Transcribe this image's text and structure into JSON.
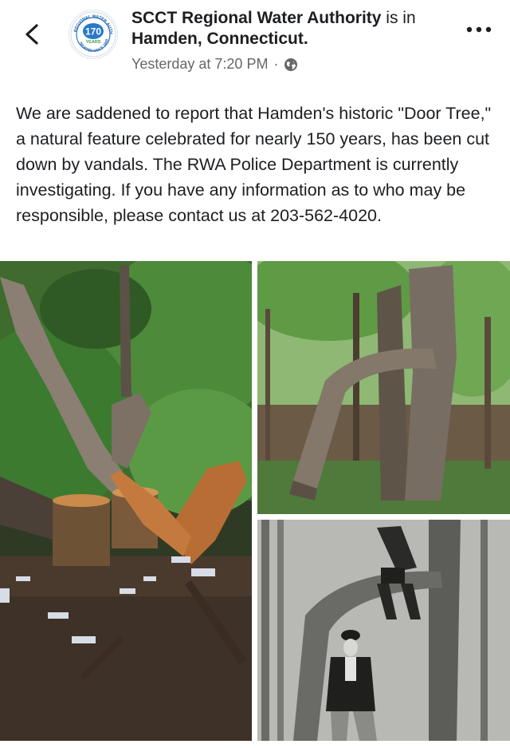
{
  "header": {
    "page_name": "SCCT Regional Water Authority",
    "checkin_prefix": " is in ",
    "location": "Hamden, Connecticut.",
    "timestamp": "Yesterday at 7:20 PM",
    "separator": "·",
    "logo": {
      "arc_text_top": "REGIONAL WATER AUTHORITY",
      "number": "170",
      "years": "YEARS",
      "arc_text_bottom": "TRUSTED SINCE 1849"
    }
  },
  "post": {
    "text": "We are saddened to report that Hamden's historic \"Door Tree,\" a natural feature celebrated for nearly 150 years, has been cut down by vandals. The RWA Police Department is currently investigating. If you have any information as to who may be responsible, please contact us at 203-562-4020."
  },
  "icons": {
    "back": "chevron-left-icon",
    "privacy": "globe-icon",
    "more": "more-options-icon"
  },
  "colors": {
    "text": "#1c1e21",
    "meta": "#65676b",
    "brand_blue": "#2a78c8"
  }
}
